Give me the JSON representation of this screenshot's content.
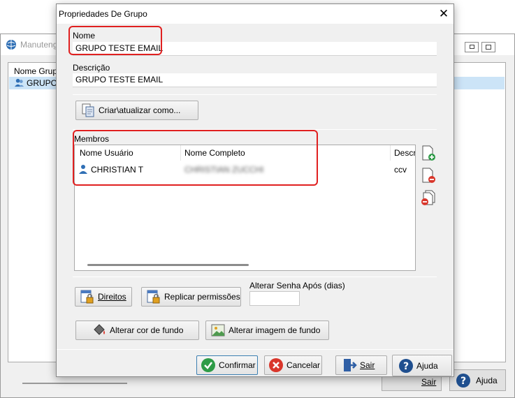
{
  "background_window": {
    "title": "Manuteng",
    "list_header": "Nome Grupo",
    "selected_row": "GRUPO T",
    "exit_label": "Sair",
    "help_label": "Ajuda"
  },
  "dialog": {
    "title": "Propriedades De Grupo",
    "name": {
      "label": "Nome",
      "value": "GRUPO TESTE EMAIL"
    },
    "description": {
      "label": "Descrição",
      "value": "GRUPO TESTE EMAIL"
    },
    "create_update_label": "Criar\\atualizar como...",
    "members": {
      "label": "Membros",
      "columns": [
        "Nome Usuário",
        "Nome Completo",
        "Descr"
      ],
      "rows": [
        {
          "username": "CHRISTIAN T",
          "full_name": "CHRISTIAN ZUCCHI",
          "description": "ccv"
        }
      ]
    },
    "rights_label": "Direitos",
    "replicate_label": "Replicar permissões",
    "password_after_label": "Alterar Senha Após (dias)",
    "password_after_value": "",
    "bg_color_label": "Alterar cor de fundo",
    "bg_image_label": "Alterar imagem de fundo",
    "footer": {
      "confirm": "Confirmar",
      "cancel": "Cancelar",
      "exit": "Sair",
      "help": "Ajuda"
    }
  }
}
